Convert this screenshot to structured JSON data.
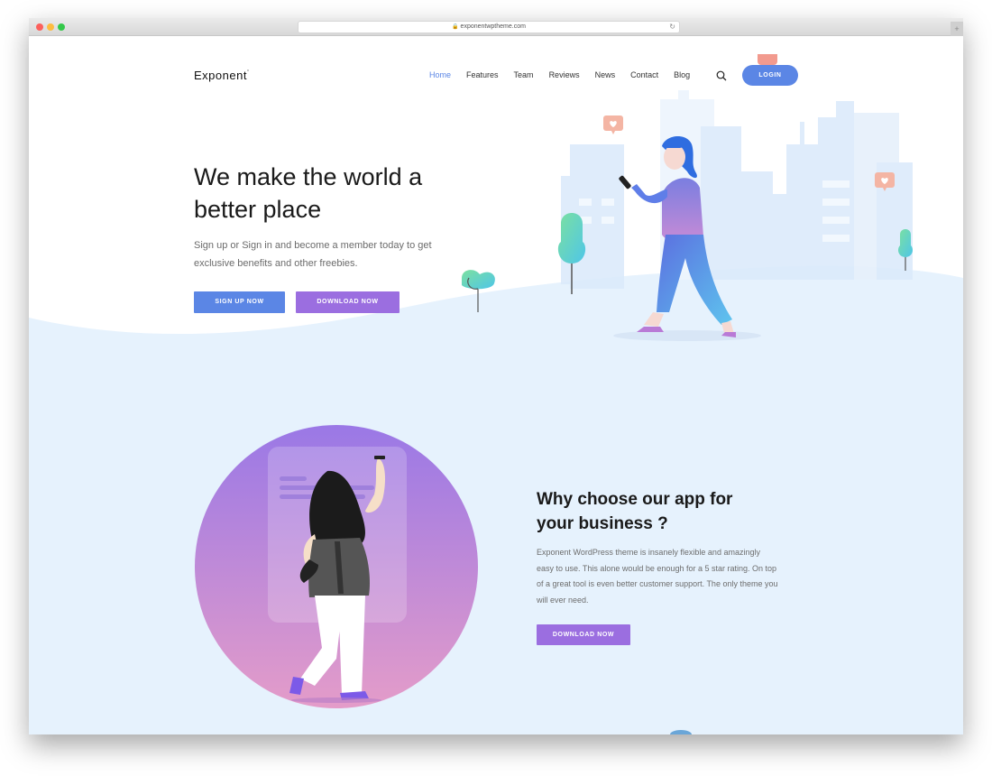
{
  "browser": {
    "url": "exponentwptheme.com",
    "lock_icon": "lock-icon",
    "reload_icon": "reload-icon",
    "new_tab_label": "+"
  },
  "header": {
    "logo": "Exponent",
    "logo_mark": "ˆ",
    "nav": [
      {
        "label": "Home",
        "active": true
      },
      {
        "label": "Features",
        "active": false
      },
      {
        "label": "Team",
        "active": false
      },
      {
        "label": "Reviews",
        "active": false
      },
      {
        "label": "News",
        "active": false
      },
      {
        "label": "Contact",
        "active": false
      },
      {
        "label": "Blog",
        "active": false
      }
    ],
    "search_icon": "search-icon",
    "login_label": "LOGIN"
  },
  "hero": {
    "title": "We make the world a better place",
    "subtitle": "Sign up or Sign in and become a member today to get exclusive benefits and other freebies.",
    "signup_label": "SIGN UP NOW",
    "download_label": "DOWNLOAD NOW"
  },
  "features": {
    "title": "Why choose our app for your business ?",
    "body": "Exponent WordPress theme is insanely flexible and amazingly easy to use. This alone would be enough for a 5 star rating. On top of a great tool is even better customer support. The only theme you will ever need.",
    "download_label": "DOWNLOAD NOW"
  },
  "colors": {
    "primary": "#5b86e5",
    "secondary": "#9b6ee0",
    "section_bg": "#e6f2fd",
    "heart": "#f29a8e"
  }
}
